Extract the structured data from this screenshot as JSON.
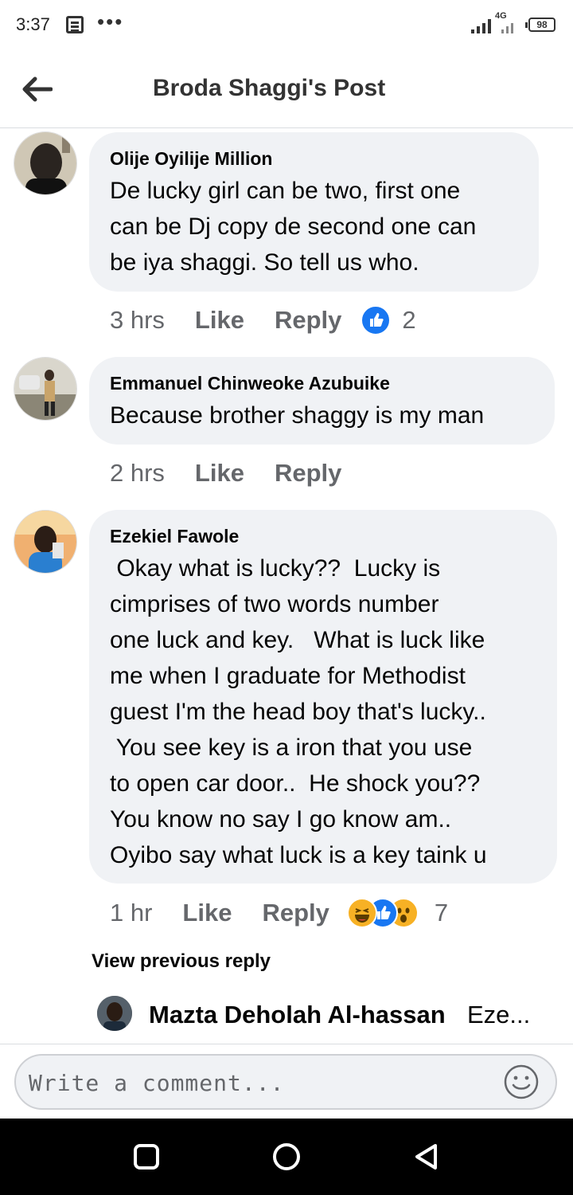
{
  "status_bar": {
    "time": "3:37",
    "network": "4G",
    "battery": "98"
  },
  "header": {
    "title": "Broda Shaggi's Post"
  },
  "comments": [
    {
      "author": "Olije Oyilije Million",
      "lines": [
        "De lucky girl can be two, first one",
        "can be Dj copy de second one can",
        "be iya shaggi. So tell us who."
      ],
      "time": "3 hrs",
      "like": "Like",
      "reply": "Reply",
      "reaction_count": "2"
    },
    {
      "author": "Emmanuel Chinweoke Azubuike",
      "lines": [
        "Because brother shaggy is my man"
      ],
      "time": "2 hrs",
      "like": "Like",
      "reply": "Reply"
    },
    {
      "author": "Ezekiel Fawole",
      "lines": [
        " Okay what is lucky??  Lucky is",
        "cimprises of two words number",
        "one luck and key.   What is luck like",
        "me when I graduate for Methodist",
        "guest I'm the head boy that's lucky..",
        " You see key is a iron that you use",
        "to open car door..  He shock you??",
        "You know no say I go know am..",
        "Oyibo say what luck is a key taink u"
      ],
      "time": "1 hr",
      "like": "Like",
      "reply": "Reply",
      "reaction_count": "7"
    }
  ],
  "view_previous": "View previous reply",
  "reply_preview": {
    "author": "Mazta Deholah Al-hassan",
    "text": "Eze..."
  },
  "composer": {
    "placeholder": "Write a comment..."
  }
}
